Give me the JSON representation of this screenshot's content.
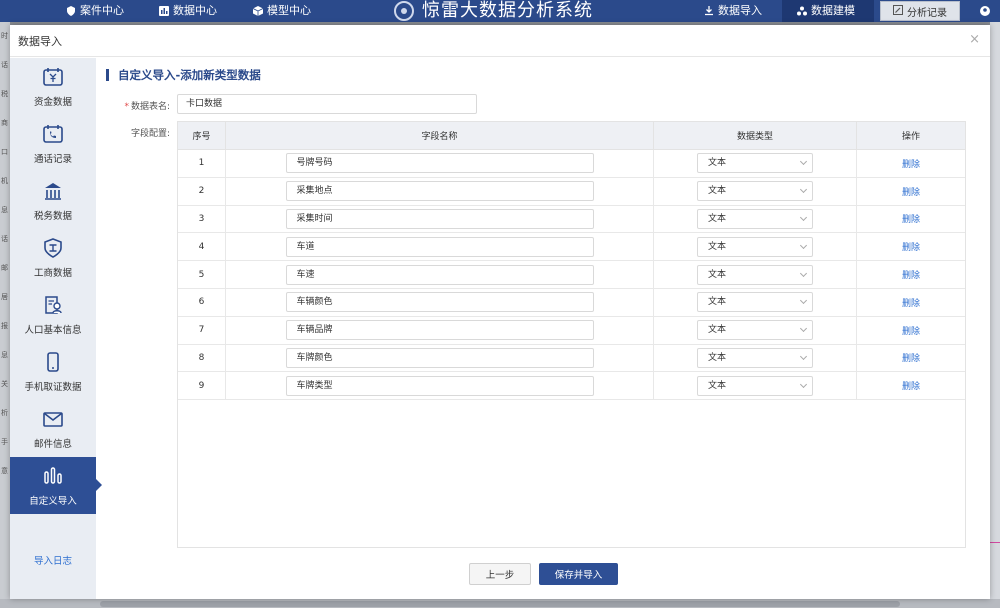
{
  "topbar": {
    "nav": [
      {
        "label": "案件中心",
        "icon": "shield-icon"
      },
      {
        "label": "数据中心",
        "icon": "chart-icon"
      },
      {
        "label": "模型中心",
        "icon": "cube-icon"
      }
    ],
    "system_title": "惊雷大数据分析系统",
    "right": [
      {
        "label": "数据导入",
        "icon": "download-icon"
      },
      {
        "label": "数据建模",
        "icon": "model-icon"
      },
      {
        "label": "分析记录",
        "icon": "edit-icon"
      }
    ]
  },
  "background_left_labels": [
    "时",
    "话",
    "税",
    "商",
    "口",
    "机",
    "息",
    "话",
    "邮",
    "居",
    "报",
    "息",
    "关",
    "析",
    "手",
    "意"
  ],
  "dialog": {
    "title": "数据导入",
    "close": "×"
  },
  "leftnav": {
    "items": [
      {
        "label": "资金数据",
        "icon": "money-icon"
      },
      {
        "label": "通话记录",
        "icon": "phone-call-icon"
      },
      {
        "label": "税务数据",
        "icon": "tax-icon"
      },
      {
        "label": "工商数据",
        "icon": "business-icon"
      },
      {
        "label": "人口基本信息",
        "icon": "person-info-icon"
      },
      {
        "label": "手机取证数据",
        "icon": "mobile-icon"
      },
      {
        "label": "邮件信息",
        "icon": "mail-icon"
      },
      {
        "label": "自定义导入",
        "icon": "custom-import-icon"
      }
    ],
    "active_index": 7,
    "log_link": "导入日志"
  },
  "content": {
    "section_title": "自定义导入-添加新类型数据",
    "name_label": "数据表名:",
    "name_value": "卡口数据",
    "fields_label": "字段配置:",
    "table": {
      "headers": [
        "序号",
        "字段名称",
        "数据类型",
        "操作"
      ],
      "rows": [
        {
          "index": "1",
          "name": "号牌号码",
          "type": "文本",
          "action": "删除"
        },
        {
          "index": "2",
          "name": "采集地点",
          "type": "文本",
          "action": "删除"
        },
        {
          "index": "3",
          "name": "采集时间",
          "type": "文本",
          "action": "删除"
        },
        {
          "index": "4",
          "name": "车道",
          "type": "文本",
          "action": "删除"
        },
        {
          "index": "5",
          "name": "车速",
          "type": "文本",
          "action": "删除"
        },
        {
          "index": "6",
          "name": "车辆颜色",
          "type": "文本",
          "action": "删除"
        },
        {
          "index": "7",
          "name": "车辆品牌",
          "type": "文本",
          "action": "删除"
        },
        {
          "index": "8",
          "name": "车牌颜色",
          "type": "文本",
          "action": "删除"
        },
        {
          "index": "9",
          "name": "车牌类型",
          "type": "文本",
          "action": "删除"
        }
      ]
    },
    "buttons": {
      "prev": "上一步",
      "save": "保存并导入"
    }
  },
  "colors": {
    "brand": "#2b4a8b",
    "active_nav": "#2e4f95",
    "link": "#2e6fd0",
    "required": "#e14b4b"
  }
}
